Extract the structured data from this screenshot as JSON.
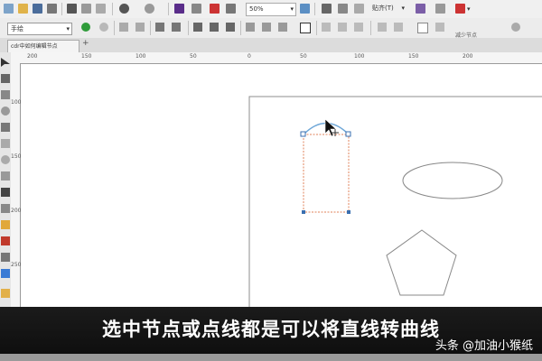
{
  "toolbar": {
    "zoom_value": "50%",
    "snap_label": "贴齐(T)",
    "shape_mode_value": "手绘",
    "reduce_nodes_label": "减少节点"
  },
  "tab": {
    "label": "cdr中如何编辑节点",
    "add": "+"
  },
  "ruler": {
    "top_ticks": [
      "200",
      "150",
      "100",
      "50",
      "0",
      "50",
      "100",
      "150",
      "200"
    ],
    "left_ticks": [
      "100",
      "150",
      "200",
      "250"
    ]
  },
  "subtitle": "选中节点或点线都是可以将直线转曲线",
  "watermark": "头条 @加油小猴纸",
  "colors": {
    "selection": "#e0835b",
    "node_curve": "#6fa7d8",
    "shape_stroke": "#888888"
  }
}
